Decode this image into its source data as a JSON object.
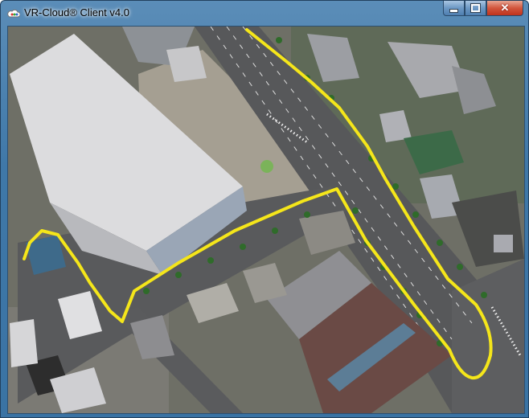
{
  "window": {
    "title": "VR-Cloud® Client v4.0",
    "controls": {
      "minimize": "minimize-icon",
      "maximize": "maximize-icon",
      "close": "close-icon"
    }
  },
  "scene": {
    "route_color": "#f5e61a",
    "road_color": "#57585a",
    "plaza_color": "#a59f92"
  }
}
